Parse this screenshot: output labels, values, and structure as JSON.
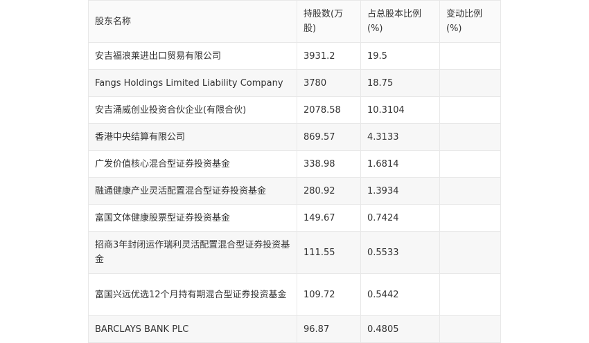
{
  "table": {
    "headers": [
      "股东名称",
      "持股数(万股)",
      "占总股本比例(%)",
      "变动比例(%)"
    ],
    "rows": [
      {
        "name": "安吉福浪莱进出口贸易有限公司",
        "shares": "3931.2",
        "ratio": "19.5",
        "change": ""
      },
      {
        "name": "Fangs Holdings Limited Liability Company",
        "shares": "3780",
        "ratio": "18.75",
        "change": ""
      },
      {
        "name": "安吉涌威创业投资合伙企业(有限合伙)",
        "shares": "2078.58",
        "ratio": "10.3104",
        "change": ""
      },
      {
        "name": "香港中央结算有限公司",
        "shares": "869.57",
        "ratio": "4.3133",
        "change": ""
      },
      {
        "name": "广发价值核心混合型证券投资基金",
        "shares": "338.98",
        "ratio": "1.6814",
        "change": ""
      },
      {
        "name": "融通健康产业灵活配置混合型证券投资基金",
        "shares": "280.92",
        "ratio": "1.3934",
        "change": ""
      },
      {
        "name": "富国文体健康股票型证券投资基金",
        "shares": "149.67",
        "ratio": "0.7424",
        "change": ""
      },
      {
        "name": "招商3年封闭运作瑞利灵活配置混合型证券投资基金",
        "shares": "111.55",
        "ratio": "0.5533",
        "change": ""
      },
      {
        "name": "富国兴远优选12个月持有期混合型证券投资基金",
        "shares": "109.72",
        "ratio": "0.5442",
        "change": ""
      },
      {
        "name": "BARCLAYS BANK PLC",
        "shares": "96.87",
        "ratio": "0.4805",
        "change": ""
      }
    ]
  }
}
